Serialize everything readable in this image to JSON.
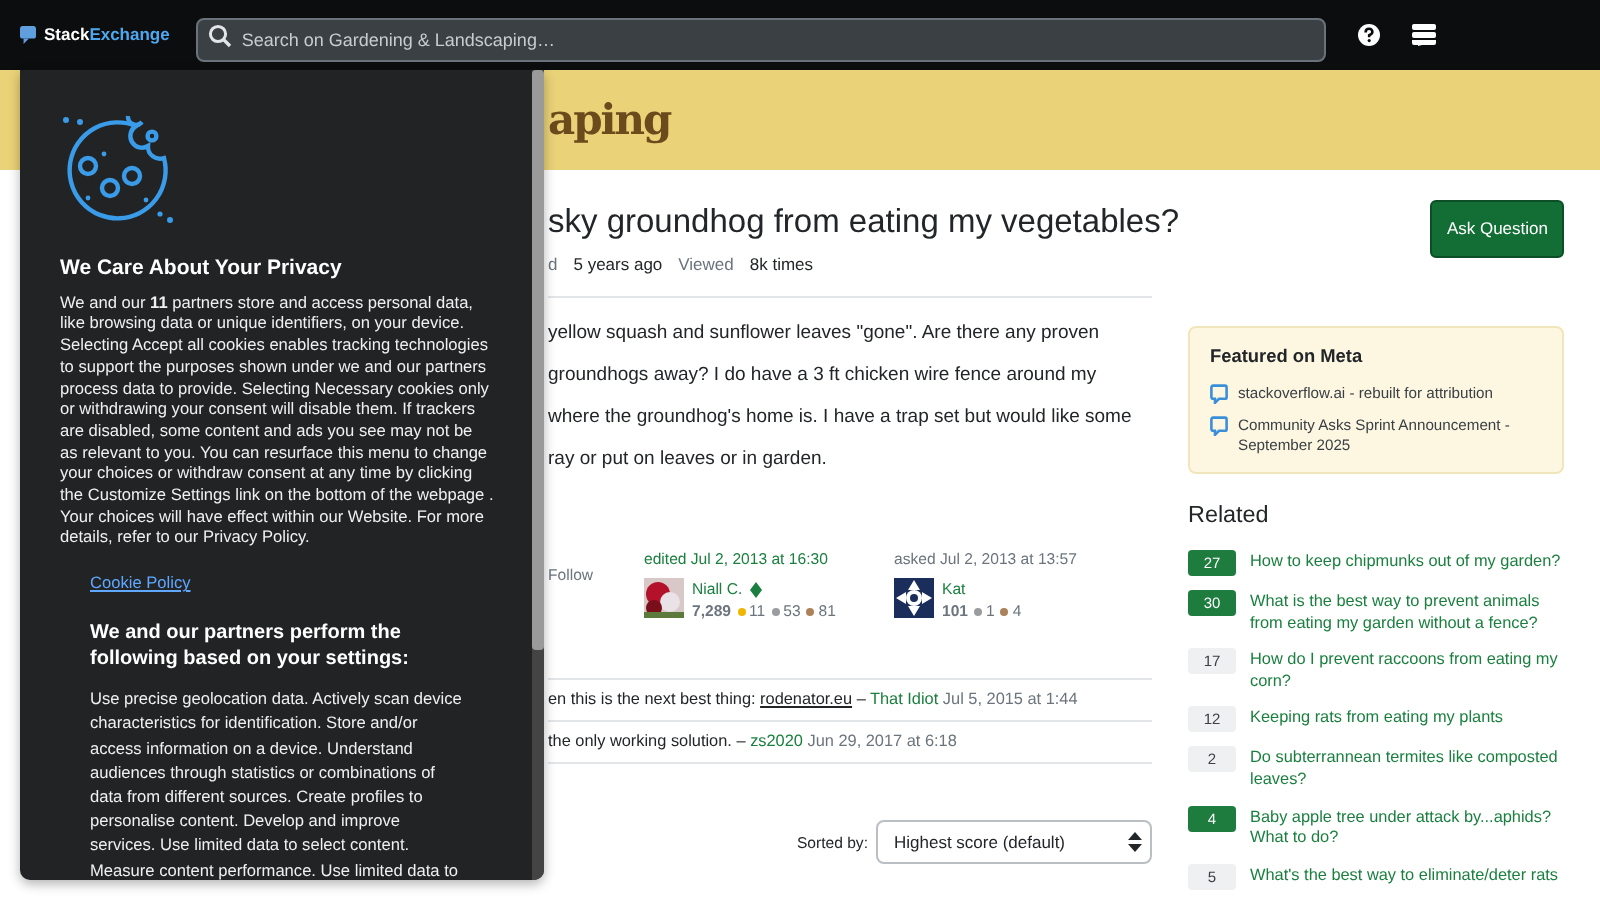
{
  "topbar": {
    "logo": {
      "first": "Stack",
      "second": "Exchange"
    },
    "search": {
      "placeholder": "Search on Gardening & Landscaping…"
    }
  },
  "site_header": {
    "title": "aping"
  },
  "question": {
    "title": "sky groundhog from eating my vegetables?",
    "ask_button": "Ask Question",
    "meta": [
      {
        "label": "d",
        "value": "5 years ago"
      },
      {
        "label": "Viewed",
        "value": "8k times"
      }
    ],
    "body_lines": [
      "yellow squash and sunflower leaves \"gone\". Are there any proven",
      "groundhogs away? I do have a 3 ft chicken wire fence around my",
      "where the groundhog's home is. I have a trap set but would like some",
      "ray or put on leaves or in garden."
    ],
    "follow": "Follow",
    "cards": [
      {
        "action": "edited Jul 2, 2013 at 16:30",
        "avatar": {
          "kind": "picture"
        },
        "name": "Niall C.",
        "moderator": true,
        "reputation": "7,289",
        "badges": [
          {
            "count": "11",
            "color": "#f1b600"
          },
          {
            "count": "53",
            "color": "#9a9c9f"
          },
          {
            "count": "81",
            "color": "#ab8259"
          }
        ]
      },
      {
        "action": "asked Jul 2, 2013 at 13:57",
        "avatar": {
          "kind": "identicon"
        },
        "name": "Kat",
        "moderator": false,
        "reputation": "101",
        "badges": [
          {
            "count": "1",
            "color": "#9a9c9f"
          },
          {
            "count": "4",
            "color": "#ab8259"
          }
        ]
      }
    ],
    "comments": [
      {
        "text": "en this is the next best thing: ",
        "link": "rodenator.eu",
        "dash": "–",
        "user": "That Idiot",
        "date": "Jul 5, 2015 at 1:44"
      },
      {
        "text": "the only working solution. ",
        "dash": "–",
        "user": "zs2020",
        "date": "Jun 29, 2017 at 6:18"
      }
    ],
    "sort": {
      "label": "Sorted by:",
      "value": "Highest score (default)"
    }
  },
  "sidebar": {
    "featured": {
      "title": "Featured on Meta",
      "items": [
        "stackoverflow.ai - rebuilt for attribution",
        "Community Asks Sprint Announcement - September 2025"
      ]
    },
    "related": {
      "title": "Related",
      "items": [
        {
          "count": "27",
          "accepted": true,
          "title": "How to keep chipmunks out of my garden?"
        },
        {
          "count": "30",
          "accepted": true,
          "title": "What is the best way to prevent animals from eating my garden without a fence?"
        },
        {
          "count": "17",
          "accepted": false,
          "title": "How do I prevent raccoons from eating my corn?"
        },
        {
          "count": "12",
          "accepted": false,
          "title": "Keeping rats from eating my plants"
        },
        {
          "count": "2",
          "accepted": false,
          "title": "Do subterrannean termites like composted leaves?"
        },
        {
          "count": "4",
          "accepted": true,
          "title": "Baby apple tree under attack by...aphids? What to do?"
        },
        {
          "count": "5",
          "accepted": false,
          "title": "What's the best way to eliminate/deter rats"
        }
      ]
    }
  },
  "cookie_dialog": {
    "title": "We Care About Your Privacy",
    "text": "We and our **11** partners store and access personal data, like browsing data or unique identifiers, on your device. Selecting Accept all cookies enables tracking technologies to support the purposes shown under we and our partners process data to provide. Selecting Necessary cookies only or withdrawing your consent will disable them. If trackers are disabled, some content and ads you see may not be as relevant to you. You can resurface this menu to change your choices or withdraw consent at any time by clicking the Customize Settings link on the bottom of the webpage . Your choices will have effect within our Website. For more details, refer to our Privacy Policy.",
    "cookie_link": "Cookie Policy",
    "heading": "We and our partners perform the following based on your settings:",
    "purposes": "Use precise geolocation data. Actively scan device characteristics for identification. Store and/or access information on a device. Understand audiences through statistics or combinations of data from different sources. Create profiles to personalise content. Develop and improve services. Use limited data to select content. Measure content performance. Use limited data to"
  }
}
